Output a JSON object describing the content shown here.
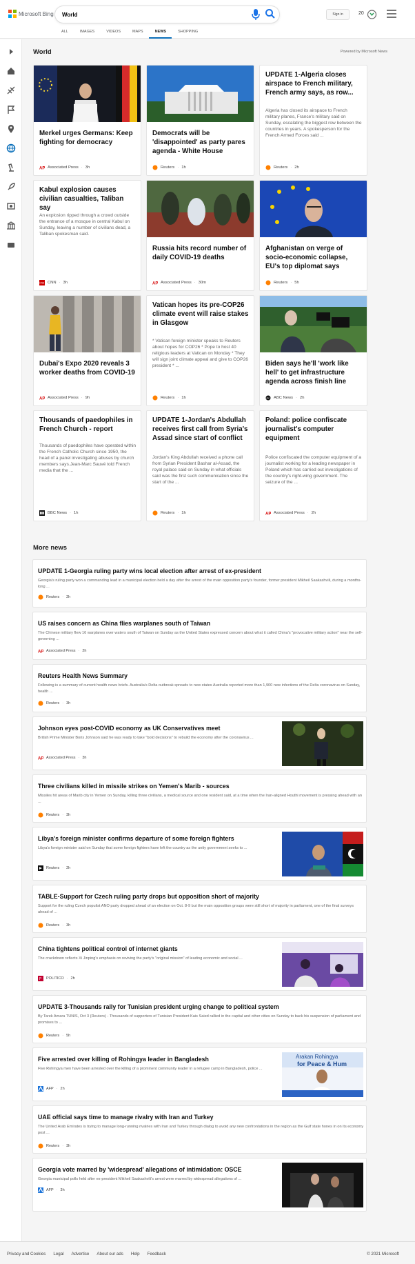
{
  "header": {
    "brand": "Microsoft Bing",
    "query": "World",
    "sign_in": "Sign in",
    "rewards_count": "20",
    "scopes": [
      "All",
      "Images",
      "Videos",
      "Maps",
      "News",
      "Shopping"
    ],
    "active_scope": "News"
  },
  "world": {
    "title": "World",
    "powered_by": "Powered by Microsoft News",
    "cards": [
      {
        "title": "Merkel urges Germans: Keep fighting for democracy",
        "source": "Associated Press",
        "time": "3h"
      },
      {
        "title": "Democrats will be 'disappointed' as party pares agenda - White House",
        "source": "Reuters",
        "time": "1h"
      },
      {
        "title": "UPDATE 1-Algeria closes airspace to French military, French army says, as row...",
        "snippet": "Algeria has closed its airspace to French military planes, France's military said on Sunday, escalating the biggest row between the countries in years. A spokesperson for the French Armed Forces said ...",
        "source": "Reuters",
        "time": "2h"
      },
      {
        "title": "Kabul explosion causes civilian casualties, Taliban say",
        "snippet": "An explosion ripped through a crowd outside the entrance of a mosque in central Kabul on Sunday, leaving a number of civilians dead, a Taliban spokesman said.",
        "source": "CNN",
        "time": "3h"
      },
      {
        "title": "Russia hits record number of daily COVID-19 deaths",
        "source": "Associated Press",
        "time": "30m"
      },
      {
        "title": "Afghanistan on verge of socio-economic collapse, EU's top diplomat says",
        "source": "Reuters",
        "time": "5h"
      },
      {
        "title": "Dubai's Expo 2020 reveals 3 worker deaths from COVID-19",
        "source": "Associated Press",
        "time": "9h"
      },
      {
        "title": "Vatican hopes its pre-COP26 climate event will raise stakes in Glasgow",
        "snippet": "* Vatican foreign minister speaks to Reuters about hopes for COP26 * Pope to host 40 religious leaders at Vatican on Monday * They will sign joint climate appeal and give to COP26 president * ...",
        "source": "Reuters",
        "time": "1h"
      },
      {
        "title": "Biden says he'll 'work like hell' to get infrastructure agenda across finish line",
        "source": "ABC News",
        "time": "2h"
      },
      {
        "title": "Thousands of paedophiles in French Church - report",
        "snippet": "Thousands of paedophiles have operated within the French Catholic Church since 1950, the head of a panel investigating abuses by church members says.Jean-Marc Sauvé told French media that the ...",
        "source": "BBC News",
        "time": "1h"
      },
      {
        "title": "UPDATE 1-Jordan's Abdullah receives first call from Syria's Assad since start of conflict",
        "snippet": "Jordan's King Abdullah received a phone call from Syrian President Bashar al-Assad, the royal palace said on Sunday in what officials said was the first such communication since the start of the ...",
        "source": "Reuters",
        "time": "1h"
      },
      {
        "title": "Poland: police confiscate journalist's computer equipment",
        "snippet": "Police confiscated the computer equipment of a journalist working for a leading newspaper in Poland which has carried out investigations of the country's right-wing government. The seizure of the ...",
        "source": "Associated Press",
        "time": "2h"
      }
    ]
  },
  "more": {
    "title": "More news",
    "items": [
      {
        "title": "UPDATE 1-Georgia ruling party wins local election after arrest of ex-president",
        "snippet": "Georgia's ruling party won a commanding lead in a municipal election held a day after the arrest of the main opposition party's founder, former president Mikheil Saakashvili, during a months-long ...",
        "source": "Reuters",
        "time": "2h"
      },
      {
        "title": "US raises concern as China flies warplanes south of Taiwan",
        "snippet": "The Chinese military flew 16 warplanes over waters south of Taiwan on Sunday as the United States expressed concern about what it called China's \"provocative military action\" near the self-governing ...",
        "source": "Associated Press",
        "time": "2h"
      },
      {
        "title": "Reuters Health News Summary",
        "snippet": "Following is a summary of current health news briefs. Australia's Delta outbreak spreads to new states Australia reported more than 1,900 new infections of the Delta coronavirus on Sunday, health ...",
        "source": "Reuters",
        "time": "3h"
      },
      {
        "title": "Johnson eyes post-COVID economy as UK Conservatives meet",
        "snippet": "British Prime Minister Boris Johnson said he was ready to take \"bold decisions\" to rebuild the economy after the coronavirus ...",
        "source": "Associated Press",
        "time": "3h"
      },
      {
        "title": "Three civilians killed in missile strikes on Yemen's Marib - sources",
        "snippet": "Missiles hit areas of Marib city in Yemen on Sunday, killing three civilians, a medical source and one resident said, at a time when the Iran-aligned Houthi movement is pressing ahead with an ...",
        "source": "Reuters",
        "time": "3h"
      },
      {
        "title": "Libya's foreign minister confirms departure of some foreign fighters",
        "snippet": "Libya's foreign minister said on Sunday that some foreign fighters have left the country as the unity government seeks to ...",
        "source": "Reuters",
        "time": "2h"
      },
      {
        "title": "TABLE-Support for Czech ruling party drops but opposition short of majority",
        "snippet": "Support for the ruling Czech populist ANO party dropped ahead of an election on Oct. 8-9 but the main opposition groups were still short of majority in parliament, one of the final surveys ahead of ...",
        "source": "Reuters",
        "time": "3h"
      },
      {
        "title": "China tightens political control of internet giants",
        "snippet": "The crackdown reflects Xi Jinping's emphasis on reviving the party's \"original mission\" of leading economic and social ...",
        "source": "POLITICO",
        "time": "2h"
      },
      {
        "title": "UPDATE 3-Thousands rally for Tunisian president urging change to political system",
        "snippet": "By Tarek Amara TUNIS, Oct 3 (Reuters) - Thousands of supporters of Tunisian President Kais Saied rallied in the capital and other cities on Sunday to back his suspension of parliament and promises to ...",
        "source": "Reuters",
        "time": "5h"
      },
      {
        "title": "Five arrested over killing of Rohingya leader in Bangladesh",
        "snippet": "Five Rohingya men have been arrested over the killing of a prominent community leader in a refugee camp in Bangladesh, police ...",
        "source": "AFP",
        "time": "2h"
      },
      {
        "title": "UAE official says time to manage rivalry with Iran and Turkey",
        "snippet": "The United Arab Emirates is trying to manage long-running rivalries with Iran and Turkey through dialog to avoid any new confrontations in the region as the Gulf state hones in on its economy post ...",
        "source": "Reuters",
        "time": "3h"
      },
      {
        "title": "Georgia vote marred by 'widespread' allegations of intimidation: OSCE",
        "snippet": "Georgia municipal polls held after ex-president Mikheil Saakashvili's arrest were marred by widespread allegations of ...",
        "source": "AFP",
        "time": "3h"
      }
    ]
  },
  "image_texts": {
    "rohingya_banner": "Arakan Rohingya for Peace & Hum"
  },
  "footer": {
    "links": [
      "Privacy and Cookies",
      "Legal",
      "Advertise",
      "About our ads",
      "Help",
      "Feedback"
    ],
    "copyright": "© 2021 Microsoft"
  },
  "colors": {
    "accent": "#0a6fba",
    "reuters": "#ff8000",
    "ap": "#d50000",
    "cnn": "#cc0000"
  },
  "icons": [
    "bing-logo",
    "mic-icon",
    "search-icon",
    "rewards-icon",
    "hamburger-menu-icon",
    "home-icon",
    "sports-icon",
    "flag-icon",
    "location-icon",
    "globe-icon",
    "science-icon",
    "rocket-icon",
    "entertainment-icon",
    "money-icon",
    "video-icon"
  ]
}
